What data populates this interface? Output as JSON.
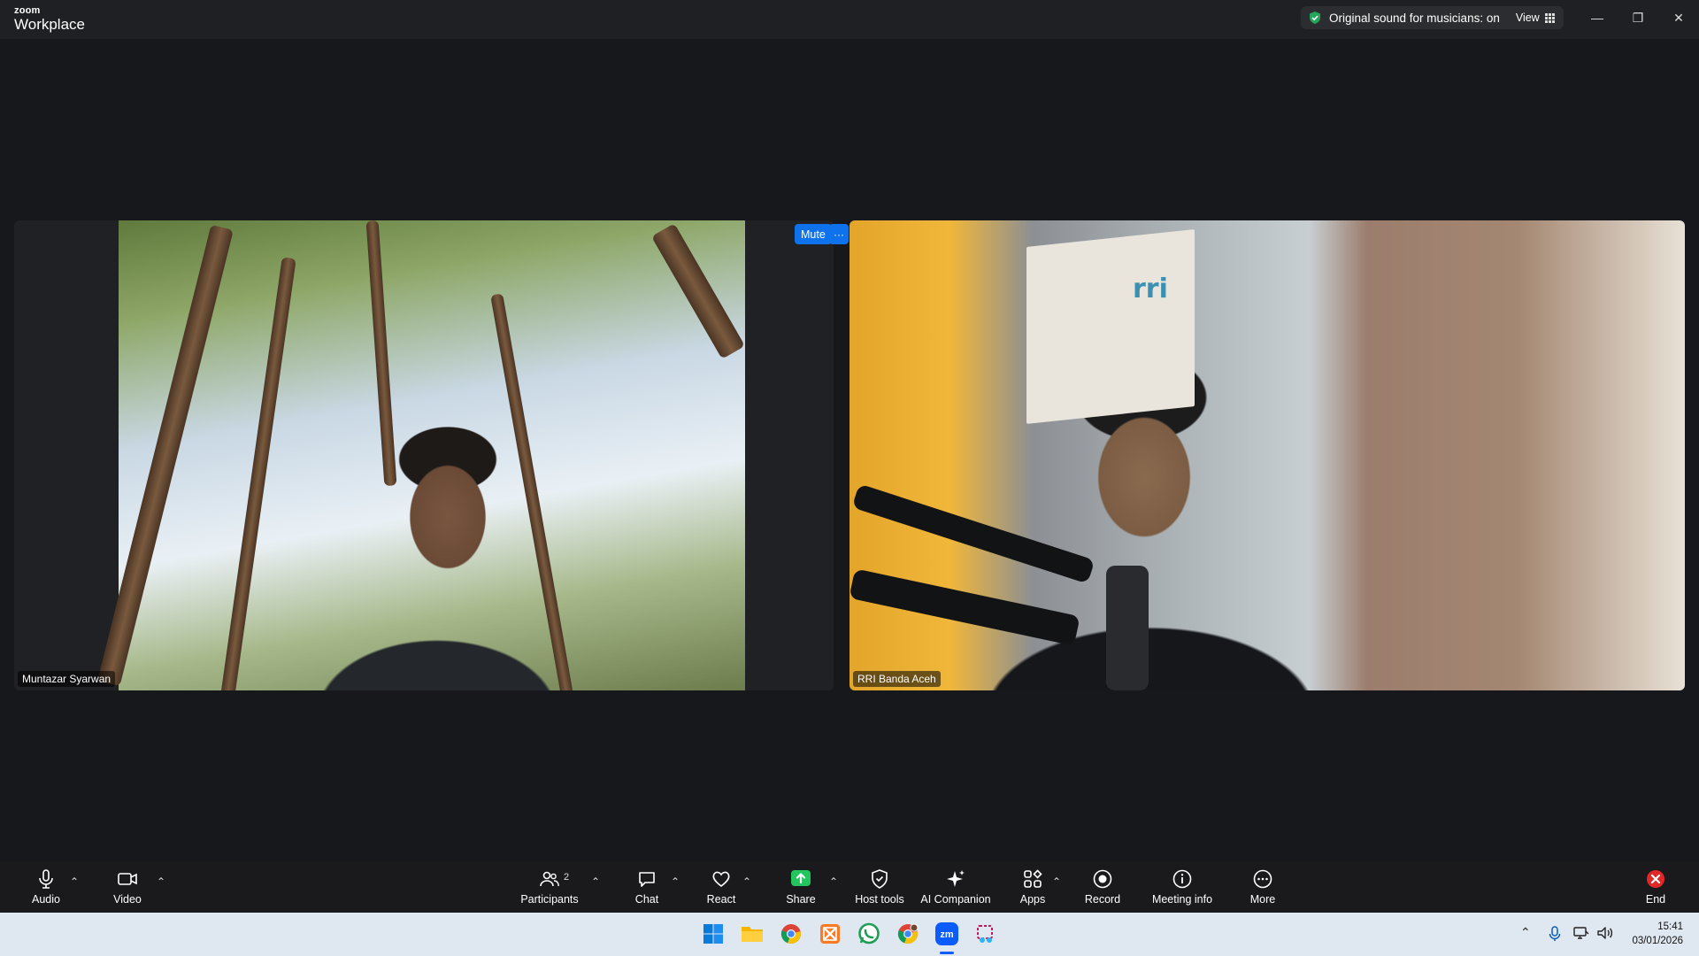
{
  "app": {
    "brand_small": "zoom",
    "brand_large": "Workplace",
    "sound_status": "Original sound for musicians: on",
    "view_label": "View"
  },
  "tiles": [
    {
      "name": "Muntazar Syarwan"
    },
    {
      "name": "RRI Banda Aceh",
      "mute_label": "Mute",
      "more_label": "···",
      "banner_text": "rri"
    }
  ],
  "toolbar": {
    "audio": "Audio",
    "video": "Video",
    "participants": "Participants",
    "participants_count": "2",
    "chat": "Chat",
    "react": "React",
    "share": "Share",
    "host_tools": "Host tools",
    "ai_companion": "AI Companion",
    "apps": "Apps",
    "record": "Record",
    "meeting_info": "Meeting info",
    "more": "More",
    "end": "End"
  },
  "taskbar": {
    "time": "15:41",
    "date": "03/01/2026",
    "apps": [
      "start-icon",
      "file-explorer-icon",
      "chrome-icon",
      "xampp-icon",
      "whatsapp-icon",
      "chrome-profile-icon",
      "zoom-icon",
      "snipping-tool-icon"
    ],
    "zoom_label": "zm"
  },
  "colors": {
    "accent_blue": "#0e72ed",
    "share_green": "#22c55e",
    "end_red": "#e02828",
    "shield_green": "#23a55a"
  }
}
